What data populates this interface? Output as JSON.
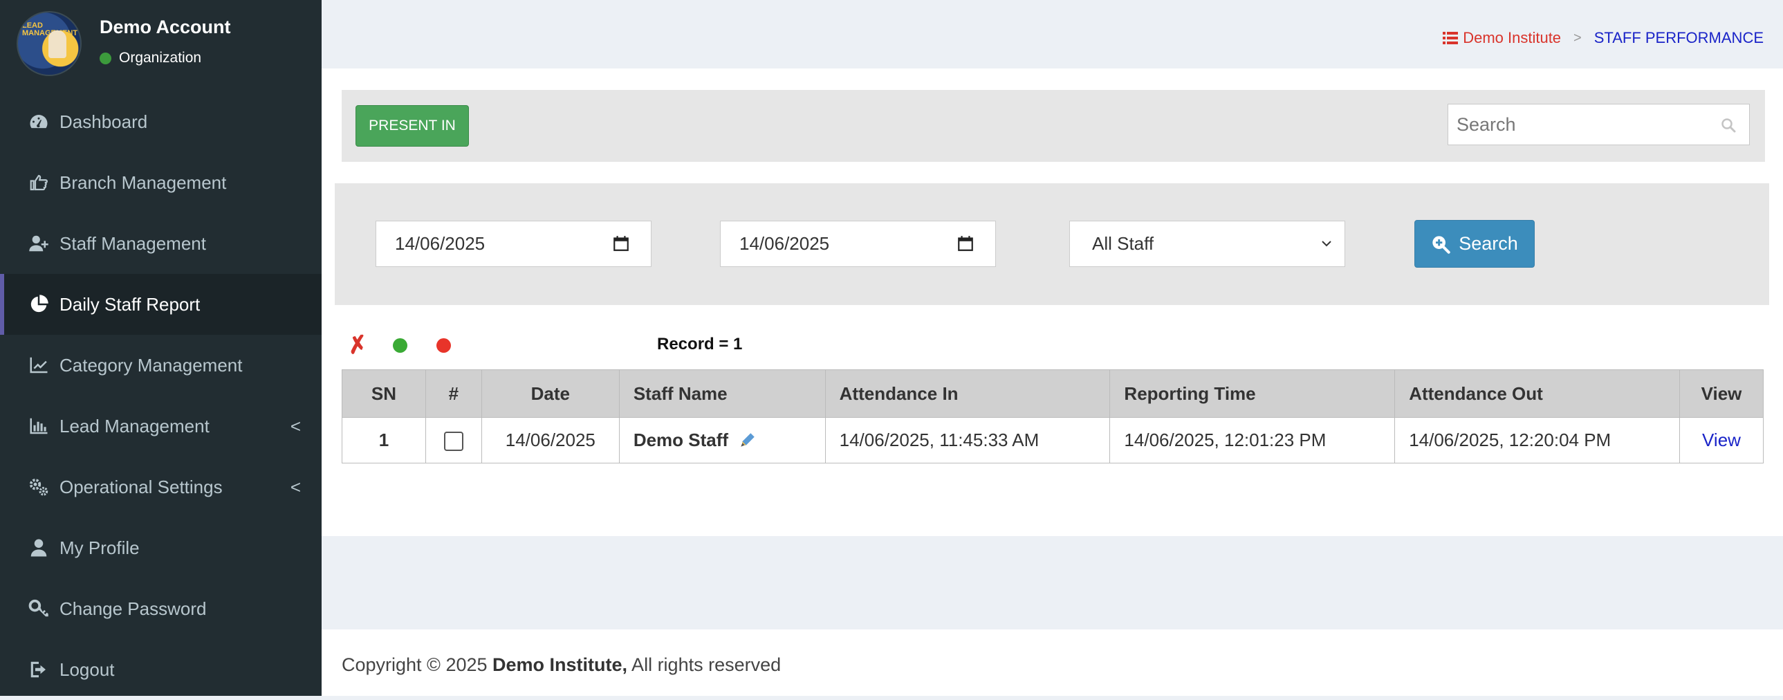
{
  "account": {
    "name": "Demo Account",
    "status": "Organization",
    "logo_text": "LEAD MANAGEMENT"
  },
  "sidebar": {
    "items": [
      {
        "label": "Dashboard",
        "icon": "dashboard-icon"
      },
      {
        "label": "Branch Management",
        "icon": "hand-pointer-icon"
      },
      {
        "label": "Staff Management",
        "icon": "user-plus-icon"
      },
      {
        "label": "Daily Staff Report",
        "icon": "pie-chart-icon",
        "active": true
      },
      {
        "label": "Category Management",
        "icon": "line-chart-icon"
      },
      {
        "label": "Lead Management",
        "icon": "bar-chart-icon",
        "has_submenu": true
      },
      {
        "label": "Operational Settings",
        "icon": "gears-icon",
        "has_submenu": true
      },
      {
        "label": "My Profile",
        "icon": "user-icon"
      },
      {
        "label": "Change Password",
        "icon": "key-icon"
      },
      {
        "label": "Logout",
        "icon": "sign-out-icon"
      }
    ],
    "chevron": "<"
  },
  "breadcrumb": {
    "home": "Demo Institute",
    "separator": ">",
    "current": "STAFF PERFORMANCE"
  },
  "toolbar": {
    "present_in_label": "PRESENT IN",
    "search_placeholder": "Search"
  },
  "filters": {
    "from_date": "14/06/2025",
    "to_date": "14/06/2025",
    "staff_selected": "All Staff",
    "search_button": "Search"
  },
  "legend": {
    "x_mark": "✗",
    "record_text": "Record = 1"
  },
  "table": {
    "headers": [
      "SN",
      "#",
      "Date",
      "Staff Name",
      "Attendance In",
      "Reporting Time",
      "Attendance Out",
      "View"
    ],
    "rows": [
      {
        "sn": "1",
        "date": "14/06/2025",
        "staff_name": "Demo Staff",
        "attendance_in": "14/06/2025, 11:45:33 AM",
        "reporting_time": "14/06/2025, 12:01:23 PM",
        "attendance_out": "14/06/2025, 12:20:04 PM",
        "view": "View"
      }
    ]
  },
  "footer": {
    "prefix": "Copyright © 2025 ",
    "org": "Demo Institute,",
    "suffix": " All rights reserved"
  },
  "colors": {
    "sidebar_bg": "#222d32",
    "active_accent": "#605ca8",
    "present_button": "#4aa55a",
    "search_button": "#3c8dbc",
    "breadcrumb_home": "#d9342b",
    "breadcrumb_current": "#1a24c8",
    "legend_green": "#3aaa35",
    "legend_red": "#e8342a"
  }
}
